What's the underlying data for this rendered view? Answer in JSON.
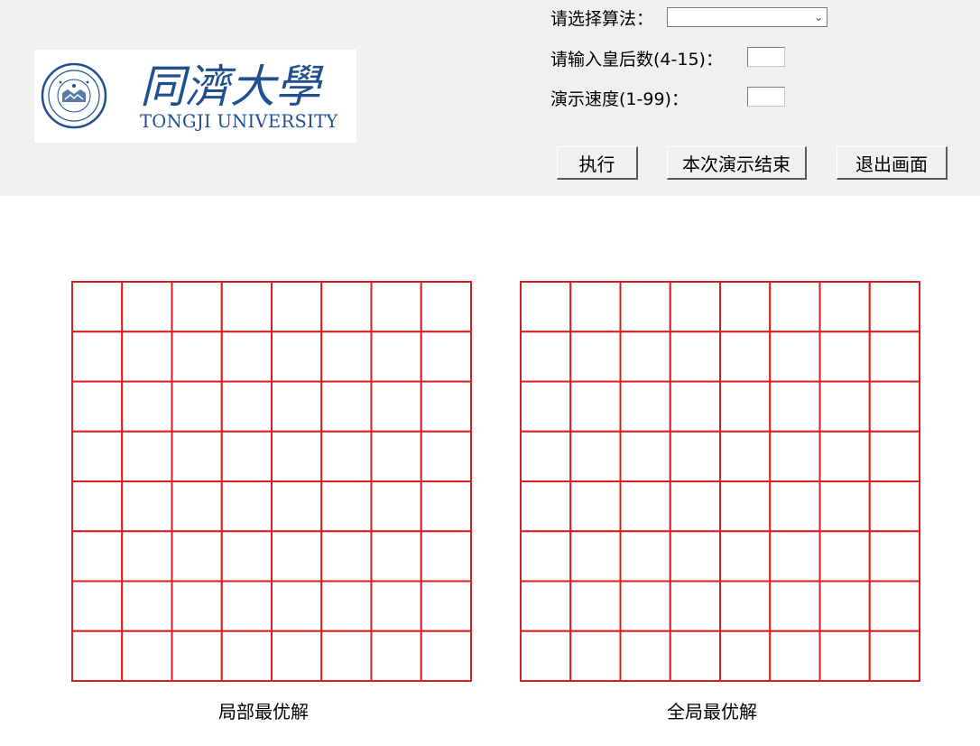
{
  "header": {
    "logo": {
      "name_cn": "同濟大學",
      "name_en": "TONGJI UNIVERSITY"
    },
    "algorithm": {
      "label": "请选择算法：",
      "value": ""
    },
    "queens": {
      "label": "请输入皇后数(4-15)：",
      "value": ""
    },
    "speed": {
      "label": "演示速度(1-99)：",
      "value": ""
    },
    "buttons": {
      "run": "执行",
      "end_demo": "本次演示结束",
      "exit": "退出画面"
    }
  },
  "boards": {
    "size": 8,
    "grid_color": "#d81e1e",
    "local_title": "局部最优解",
    "global_title": "全局最优解"
  },
  "colors": {
    "panel_bg": "#f0f0f0",
    "logo_blue": "#1f4f8f"
  }
}
